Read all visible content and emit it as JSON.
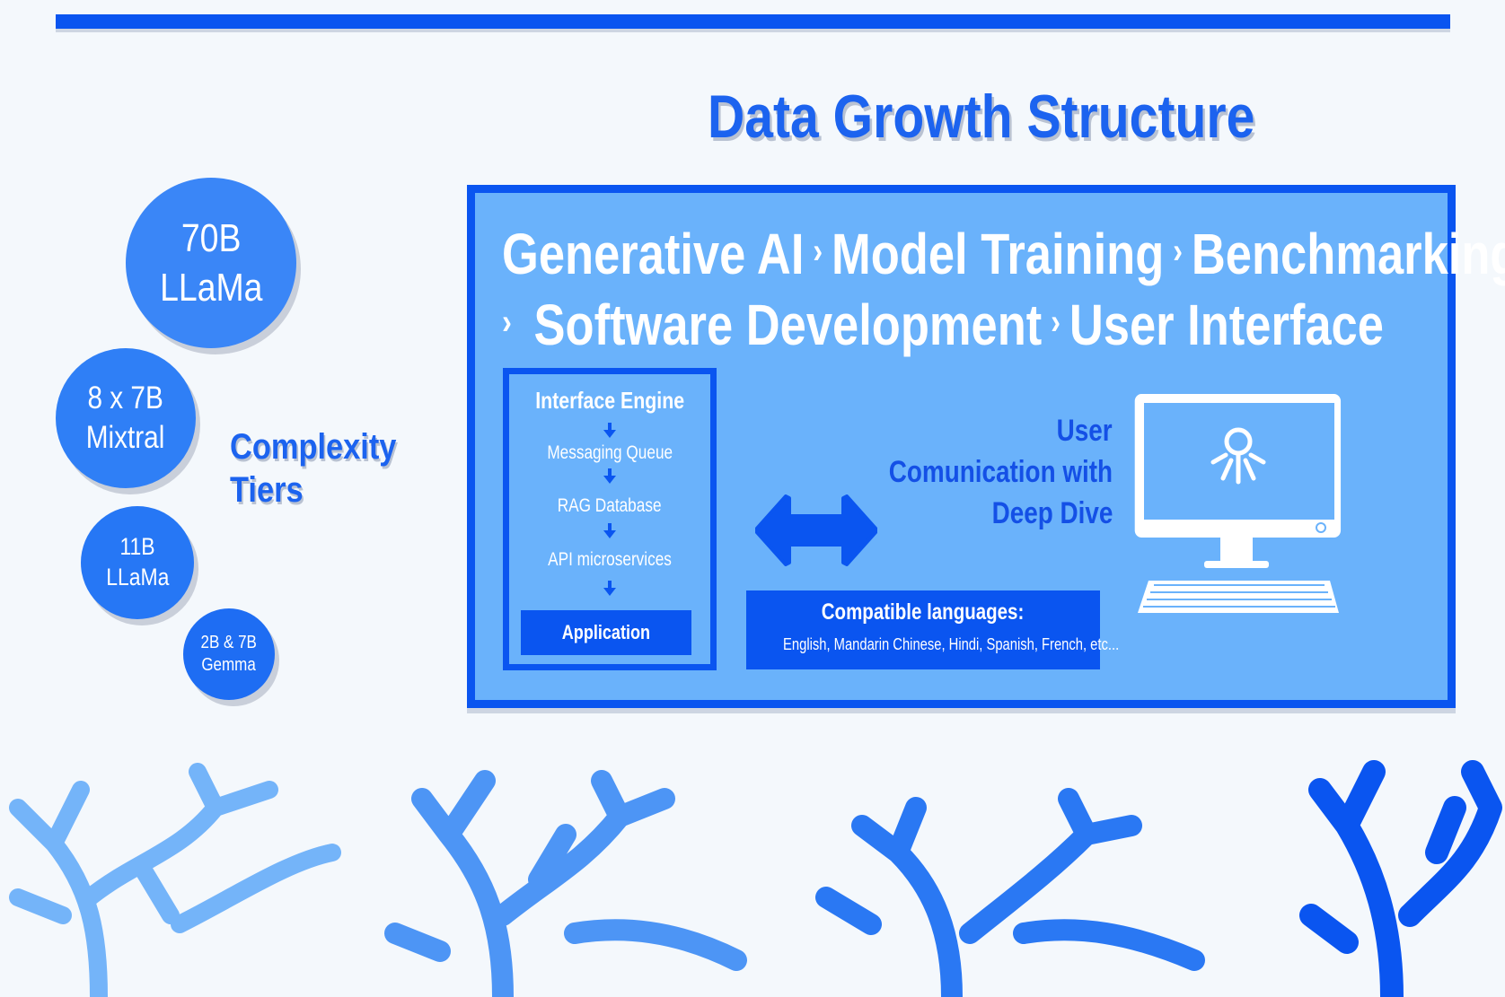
{
  "page": {
    "title": "Data Growth Structure"
  },
  "tiers": {
    "label_line1": "Complexity",
    "label_line2": "Tiers",
    "items": [
      {
        "line1": "70B",
        "line2": "LLaMa"
      },
      {
        "line1": "8 x 7B",
        "line2": "Mixtral"
      },
      {
        "line1": "11B",
        "line2": "LLaMa"
      },
      {
        "line1": "2B & 7B",
        "line2": "Gemma"
      }
    ]
  },
  "pipeline": {
    "stages": [
      "Generative AI",
      "Model Training",
      "Benchmarking",
      "Software Development",
      "User Interface"
    ],
    "separator": "›"
  },
  "engine": {
    "title": "Interface Engine",
    "steps": [
      "Messaging Queue",
      "RAG Database",
      "API microservices"
    ],
    "application_label": "Application"
  },
  "user": {
    "line1": "User",
    "line2": "Comunication with",
    "line3": "Deep Dive"
  },
  "languages": {
    "title": "Compatible languages:",
    "list": "English, Mandarin Chinese, Hindi, Spanish, French, etc..."
  },
  "icons": {
    "connection": "double-arrow-icon",
    "monitor": "computer-monitor-icon",
    "keyboard": "keyboard-icon",
    "user": "octopus-user-icon",
    "decor": "coral-icon"
  },
  "colors": {
    "primary": "#0a55f0",
    "panel": "#6ab2fb",
    "accent_text": "#1c63ef",
    "background": "#f4f8fc"
  }
}
